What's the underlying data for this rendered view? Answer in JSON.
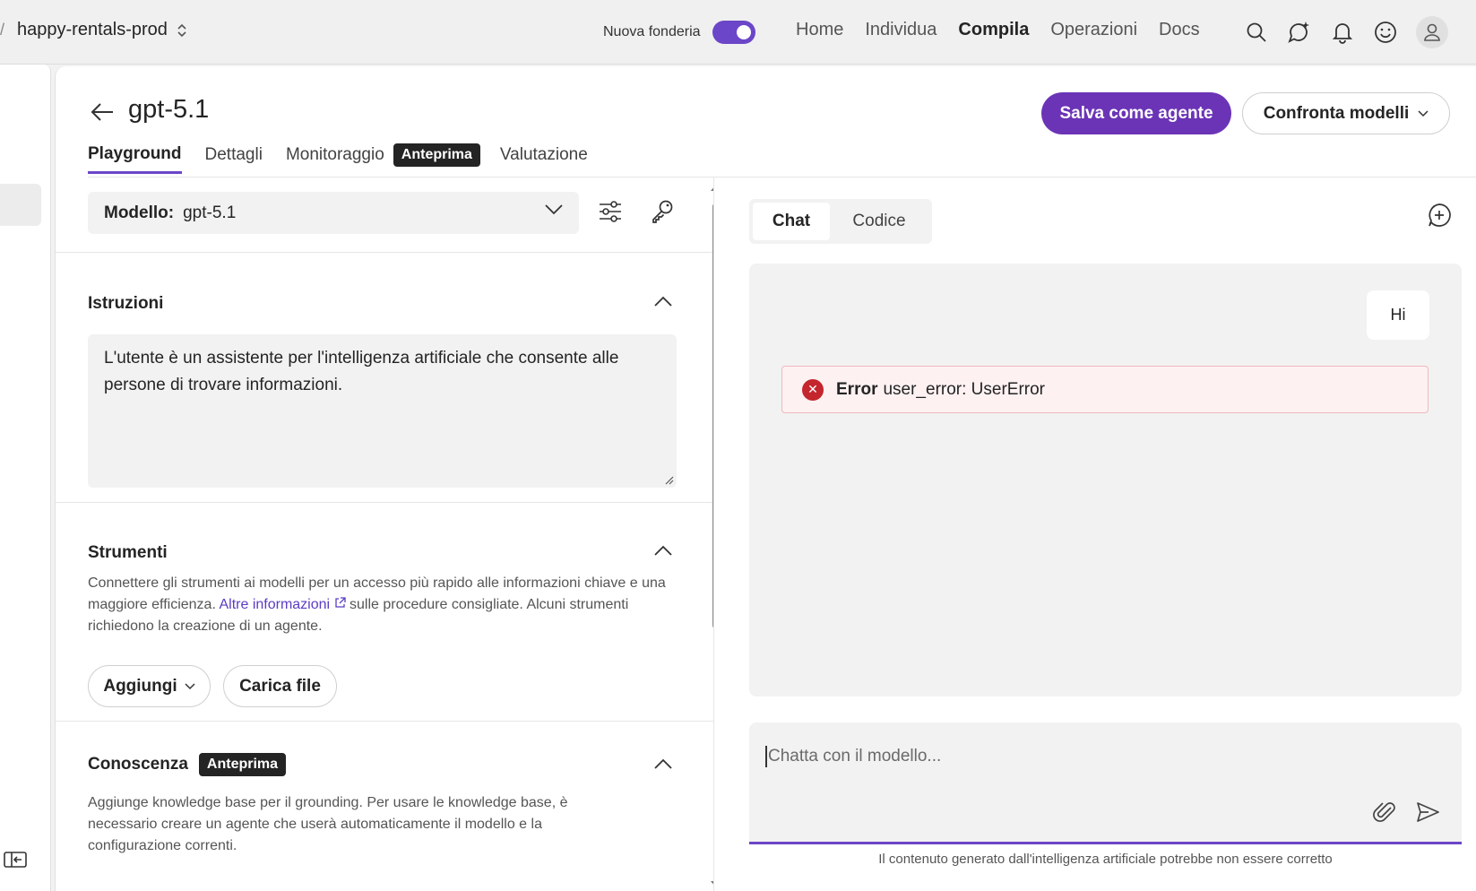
{
  "topbar": {
    "project_name": "happy-rentals-prod",
    "toggle_label": "Nuova fonderia",
    "nav": [
      "Home",
      "Individua",
      "Compila",
      "Operazioni",
      "Docs"
    ],
    "active_nav": "Compila",
    "accent_color": "#6b46c8"
  },
  "header": {
    "title": "gpt-5.1",
    "tabs": [
      "Playground",
      "Dettagli",
      "Monitoraggio",
      "Valutazione"
    ],
    "preview_badge": "Anteprima",
    "save_agent": "Salva come agente",
    "compare_models": "Confronta modelli"
  },
  "left": {
    "model_label": "Modello:",
    "model_value": "gpt-5.1",
    "instructions_title": "Istruzioni",
    "instructions_text": "L'utente è un assistente per l'intelligenza artificiale che consente alle persone di trovare informazioni.",
    "tools_title": "Strumenti",
    "tools_desc_1": "Connettere gli strumenti ai modelli per un accesso più rapido alle informazioni chiave e una maggiore efficienza.",
    "tools_link": "Altre informazioni",
    "tools_desc_2": "sulle procedure consigliate. Alcuni strumenti richiedono la creazione di un agente.",
    "add_button": "Aggiungi",
    "upload_button": "Carica file",
    "knowledge_title": "Conoscenza",
    "knowledge_badge": "Anteprima",
    "knowledge_desc": "Aggiunge knowledge base per il grounding. Per usare le knowledge base, è necessario creare un agente che userà automaticamente il modello e la configurazione correnti."
  },
  "right": {
    "seg_chat": "Chat",
    "seg_code": "Codice",
    "user_message": "Hi",
    "error_label": "Error",
    "error_text": "user_error: UserError",
    "input_placeholder": "Chatta con il modello...",
    "disclaimer": "Il contenuto generato dall'intelligenza artificiale potrebbe non essere corretto"
  }
}
